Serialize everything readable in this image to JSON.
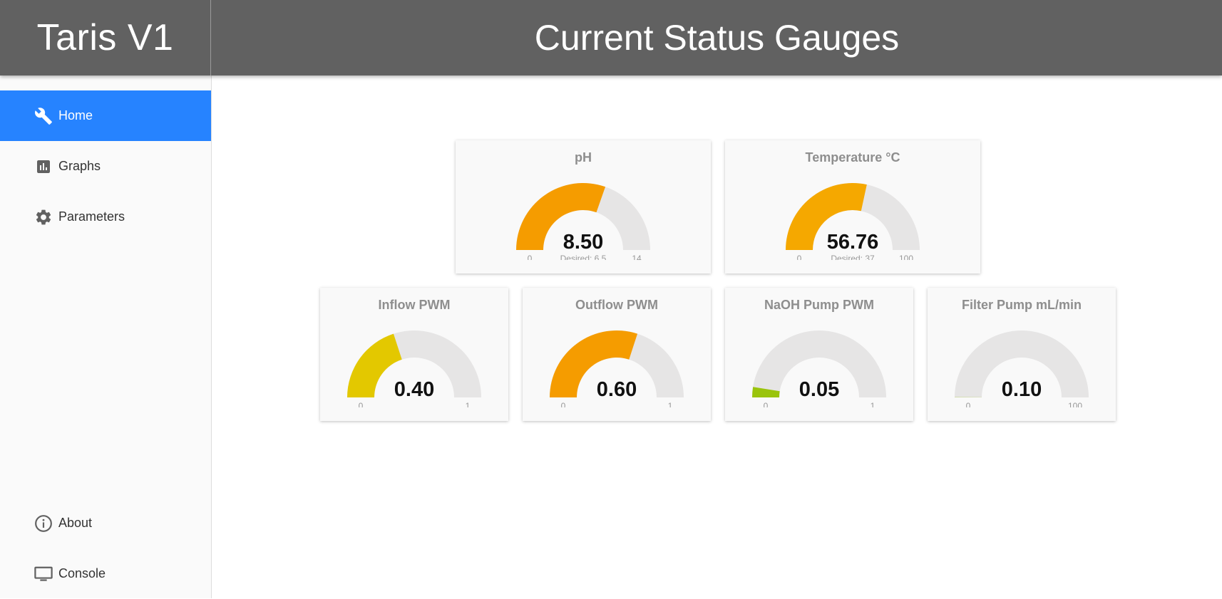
{
  "app": {
    "brand": "Taris V1",
    "page_title": "Current Status Gauges"
  },
  "sidebar": {
    "items": [
      {
        "label": "Home",
        "icon": "wrench-icon",
        "active": true
      },
      {
        "label": "Graphs",
        "icon": "bar-chart-icon",
        "active": false
      },
      {
        "label": "Parameters",
        "icon": "gear-icon",
        "active": false
      }
    ],
    "bottom_items": [
      {
        "label": "About",
        "icon": "info-icon"
      },
      {
        "label": "Console",
        "icon": "monitor-icon"
      }
    ]
  },
  "gauges": [
    {
      "title": "pH",
      "value": 8.5,
      "display": "8.50",
      "min": "0",
      "max": "14",
      "range_max": 14,
      "desired": "Desired: 6.5",
      "color": "#f59c00"
    },
    {
      "title": "Temperature °C",
      "value": 56.76,
      "display": "56.76",
      "min": "0",
      "max": "100",
      "range_max": 100,
      "desired": "Desired: 37",
      "color": "#f5a800"
    },
    {
      "title": "Inflow PWM",
      "value": 0.4,
      "display": "0.40",
      "min": "0",
      "max": "1",
      "range_max": 1,
      "desired": "",
      "color": "#e3c800"
    },
    {
      "title": "Outflow PWM",
      "value": 0.6,
      "display": "0.60",
      "min": "0",
      "max": "1",
      "range_max": 1,
      "desired": "",
      "color": "#f59c00"
    },
    {
      "title": "NaOH Pump PWM",
      "value": 0.05,
      "display": "0.05",
      "min": "0",
      "max": "1",
      "range_max": 1,
      "desired": "",
      "color": "#9ac40c"
    },
    {
      "title": "Filter Pump mL/min",
      "value": 0.1,
      "display": "0.10",
      "min": "0",
      "max": "100",
      "range_max": 100,
      "desired": "",
      "color": "#9ac40c"
    }
  ],
  "colors": {
    "header_bg": "#616161",
    "active_nav": "#2683ff",
    "gauge_track": "#e6e5e5"
  }
}
